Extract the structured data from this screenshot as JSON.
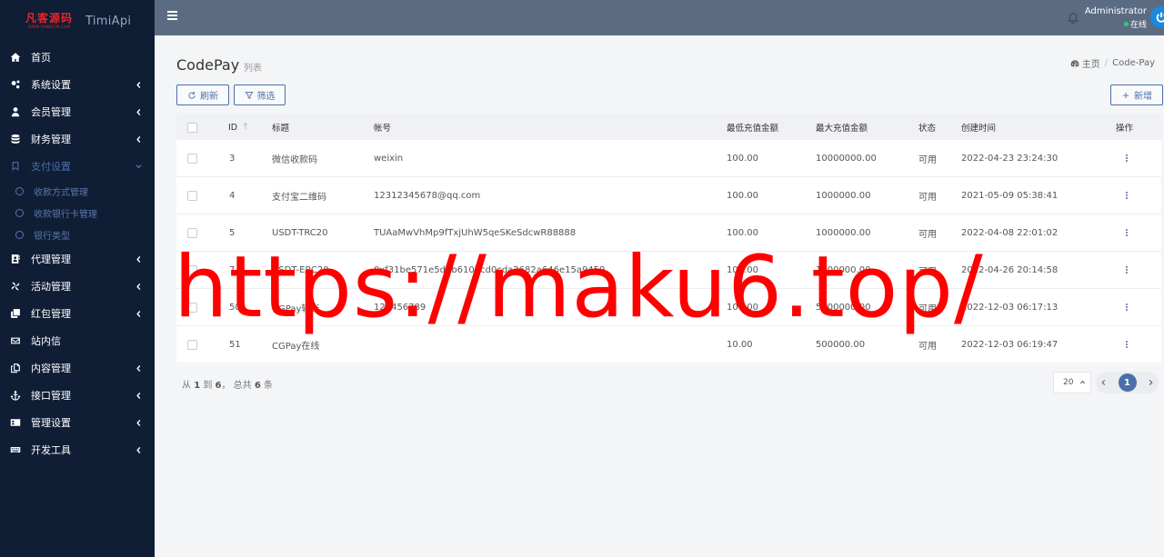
{
  "brand": {
    "logo_zh": "凡客源码",
    "logo_en": "WWW.FANKEYM.COM",
    "name": "TimiApi"
  },
  "sidebar": {
    "items": [
      {
        "label": "首页",
        "icon": "home-icon",
        "has_children": false
      },
      {
        "label": "系统设置",
        "icon": "cogs-icon",
        "has_children": true
      },
      {
        "label": "会员管理",
        "icon": "user-icon",
        "has_children": true
      },
      {
        "label": "财务管理",
        "icon": "database-icon",
        "has_children": true
      },
      {
        "label": "支付设置",
        "icon": "bookmark-icon",
        "has_children": true,
        "open": true
      },
      {
        "label": "代理管理",
        "icon": "contact-icon",
        "has_children": true
      },
      {
        "label": "活动管理",
        "icon": "pinwheel-icon",
        "has_children": true
      },
      {
        "label": "红包管理",
        "icon": "clone-icon",
        "has_children": true
      },
      {
        "label": "站内信",
        "icon": "envelope-icon",
        "has_children": false
      },
      {
        "label": "内容管理",
        "icon": "copy-icon",
        "has_children": true
      },
      {
        "label": "接口管理",
        "icon": "anchor-icon",
        "has_children": true
      },
      {
        "label": "管理设置",
        "icon": "id-card-icon",
        "has_children": true
      },
      {
        "label": "开发工具",
        "icon": "keyboard-icon",
        "has_children": true
      }
    ],
    "submenu": [
      "收款方式管理",
      "收款银行卡管理",
      "银行类型"
    ]
  },
  "topbar": {
    "user_name": "Administrator",
    "user_status": "在线"
  },
  "page": {
    "title": "CodePay",
    "subtitle": "列表"
  },
  "breadcrumb": {
    "home": "主页",
    "current": "Code-Pay"
  },
  "toolbar": {
    "refresh": "刷新",
    "filter": "筛选",
    "add": "新增"
  },
  "table": {
    "headers": {
      "id": "ID",
      "title": "标题",
      "account": "帐号",
      "min": "最低充值金额",
      "max": "最大充值金额",
      "status": "状态",
      "created": "创建时间",
      "actions": "操作"
    },
    "rows": [
      {
        "id": "3",
        "title": "微信收款码",
        "account": "weixin",
        "min": "100.00",
        "max": "10000000.00",
        "status": "可用",
        "created": "2022-04-23 23:24:30"
      },
      {
        "id": "4",
        "title": "支付宝二维码",
        "account": "12312345678@qq.com",
        "min": "100.00",
        "max": "1000000.00",
        "status": "可用",
        "created": "2021-05-09 05:38:41"
      },
      {
        "id": "5",
        "title": "USDT-TRC20",
        "account": "TUAaMwVhMp9fTxjUhW5qeSKeSdcwR88888",
        "min": "100.00",
        "max": "1000000.00",
        "status": "可用",
        "created": "2022-04-08 22:01:02"
      },
      {
        "id": "7",
        "title": "USDT-ERC20",
        "account": "0xf31be571e5d8b610bcd0cda2682a646e15a9459",
        "min": "100.00",
        "max": "1000000.00",
        "status": "可用",
        "created": "2022-04-26 20:14:58"
      },
      {
        "id": "50",
        "title": "CGPay转账",
        "account": "123456789",
        "min": "100.00",
        "max": "5000000.00",
        "status": "可用",
        "created": "2022-12-03 06:17:13"
      },
      {
        "id": "51",
        "title": "CGPay在线",
        "account": "",
        "min": "10.00",
        "max": "500000.00",
        "status": "可用",
        "created": "2022-12-03 06:19:47"
      }
    ]
  },
  "pager": {
    "from_label": "从",
    "from": "1",
    "to_label": "到",
    "to": "6",
    "total_label": "， 总共",
    "total": "6",
    "unit": "条",
    "page_size": "20",
    "current_page": "1"
  },
  "watermark": "https://maku6.top/"
}
